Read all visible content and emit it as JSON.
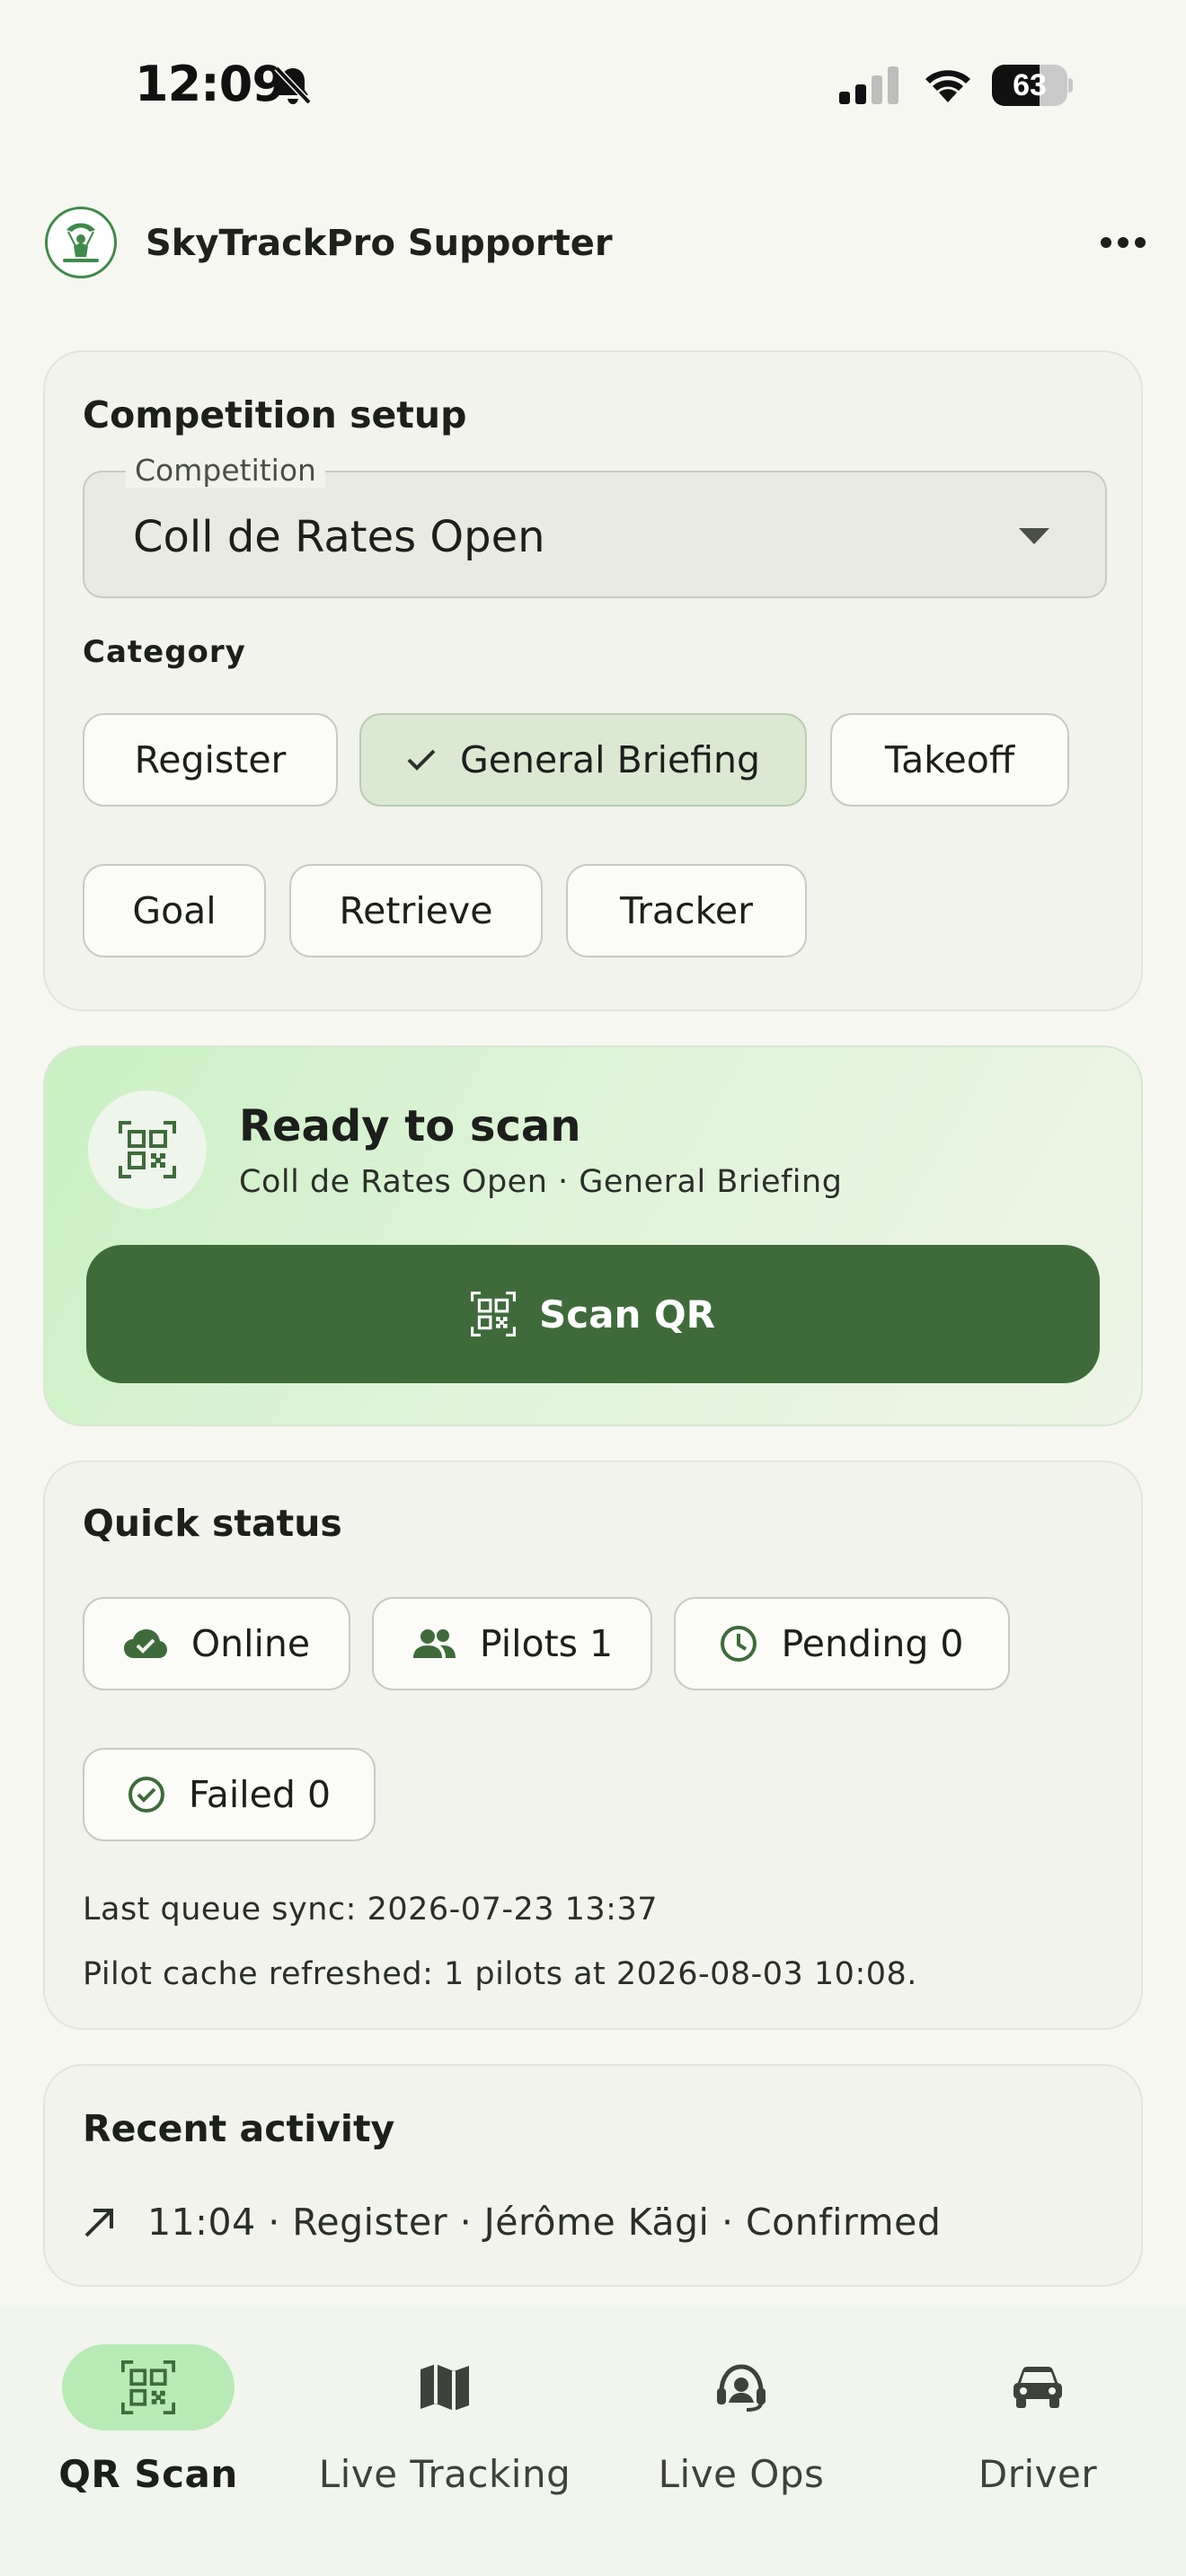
{
  "status_bar": {
    "time": "12:09",
    "battery_percent": "63",
    "battery_level": 0.63
  },
  "app_bar": {
    "title": "SkyTrackPro Supporter",
    "logo_icon": "paraglider-logo-icon",
    "menu_icon": "more-horizontal-icon"
  },
  "setup": {
    "title": "Competition setup",
    "competition_label": "Competition",
    "competition_value": "Coll de Rates Open",
    "category_label": "Category",
    "categories": [
      {
        "label": "Register",
        "selected": false
      },
      {
        "label": "General Briefing",
        "selected": true
      },
      {
        "label": "Takeoff",
        "selected": false
      },
      {
        "label": "Goal",
        "selected": false
      },
      {
        "label": "Retrieve",
        "selected": false
      },
      {
        "label": "Tracker",
        "selected": false
      }
    ]
  },
  "ready": {
    "title": "Ready to scan",
    "subtitle": "Coll de Rates Open · General Briefing",
    "scan_button": "Scan QR"
  },
  "quick_status": {
    "title": "Quick status",
    "chips": [
      {
        "label": "Online",
        "icon": "cloud-done-icon"
      },
      {
        "label": "Pilots 1",
        "icon": "group-icon"
      },
      {
        "label": "Pending 0",
        "icon": "clock-icon"
      },
      {
        "label": "Failed 0",
        "icon": "check-circle-icon"
      }
    ],
    "last_sync": "Last queue sync: 2026-07-23 13:37",
    "cache_refreshed": "Pilot cache refreshed: 1 pilots at 2026-08-03 10:08."
  },
  "recent": {
    "title": "Recent activity",
    "items": [
      {
        "text": "11:04 · Register · Jérôme Kägi · Confirmed",
        "icon": "arrow-up-right-icon"
      }
    ]
  },
  "nav": {
    "items": [
      {
        "label": "QR Scan",
        "icon": "qr-code-icon",
        "active": true
      },
      {
        "label": "Live Tracking",
        "icon": "map-icon",
        "active": false
      },
      {
        "label": "Live Ops",
        "icon": "headset-icon",
        "active": false
      },
      {
        "label": "Driver",
        "icon": "car-icon",
        "active": false
      }
    ]
  },
  "colors": {
    "accent_dark_green": "#3f6b3b",
    "selected_chip": "#dbe9d3",
    "active_nav_pill": "#b8eab5",
    "background": "#f6f7f1"
  }
}
